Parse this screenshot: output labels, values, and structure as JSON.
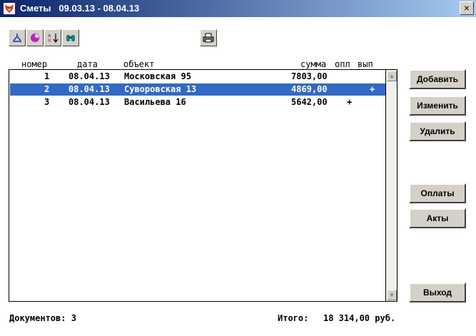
{
  "window": {
    "title_app": "Сметы",
    "title_period": "09.03.13 - 08.04.13",
    "close_label": "×"
  },
  "toolbar": {
    "buttons": [
      {
        "icon": "tree-structure-icon"
      },
      {
        "icon": "pie-chart-icon"
      },
      {
        "icon": "sort-az-icon"
      },
      {
        "icon": "binoculars-icon"
      },
      {
        "icon": "printer-icon"
      }
    ]
  },
  "table": {
    "columns": [
      "номер",
      "дата",
      "объект",
      "сумма",
      "опл",
      "вып"
    ],
    "rows": [
      {
        "number": "1",
        "date": "08.04.13",
        "object": "Московская 95",
        "sum": "7803,00",
        "paid": "",
        "done": "",
        "selected": false
      },
      {
        "number": "2",
        "date": "08.04.13",
        "object": "Суворовская 13",
        "sum": "4869,00",
        "paid": "",
        "done": "+",
        "selected": true
      },
      {
        "number": "3",
        "date": "08.04.13",
        "object": "Васильева 16",
        "sum": "5642,00",
        "paid": "+",
        "done": "",
        "selected": false
      }
    ]
  },
  "actions": {
    "add": "Добавить",
    "edit": "Изменить",
    "delete": "Удалить",
    "payments": "Оплаты",
    "acts": "Акты",
    "exit": "Выход"
  },
  "footer": {
    "documents_label": "Документов: 3",
    "total_label": "Итого:",
    "total_value": "18 314,00 руб."
  },
  "colors": {
    "selection": "#316ac5",
    "titlebar": "#0a246a",
    "button_face": "#d4d0c8"
  }
}
